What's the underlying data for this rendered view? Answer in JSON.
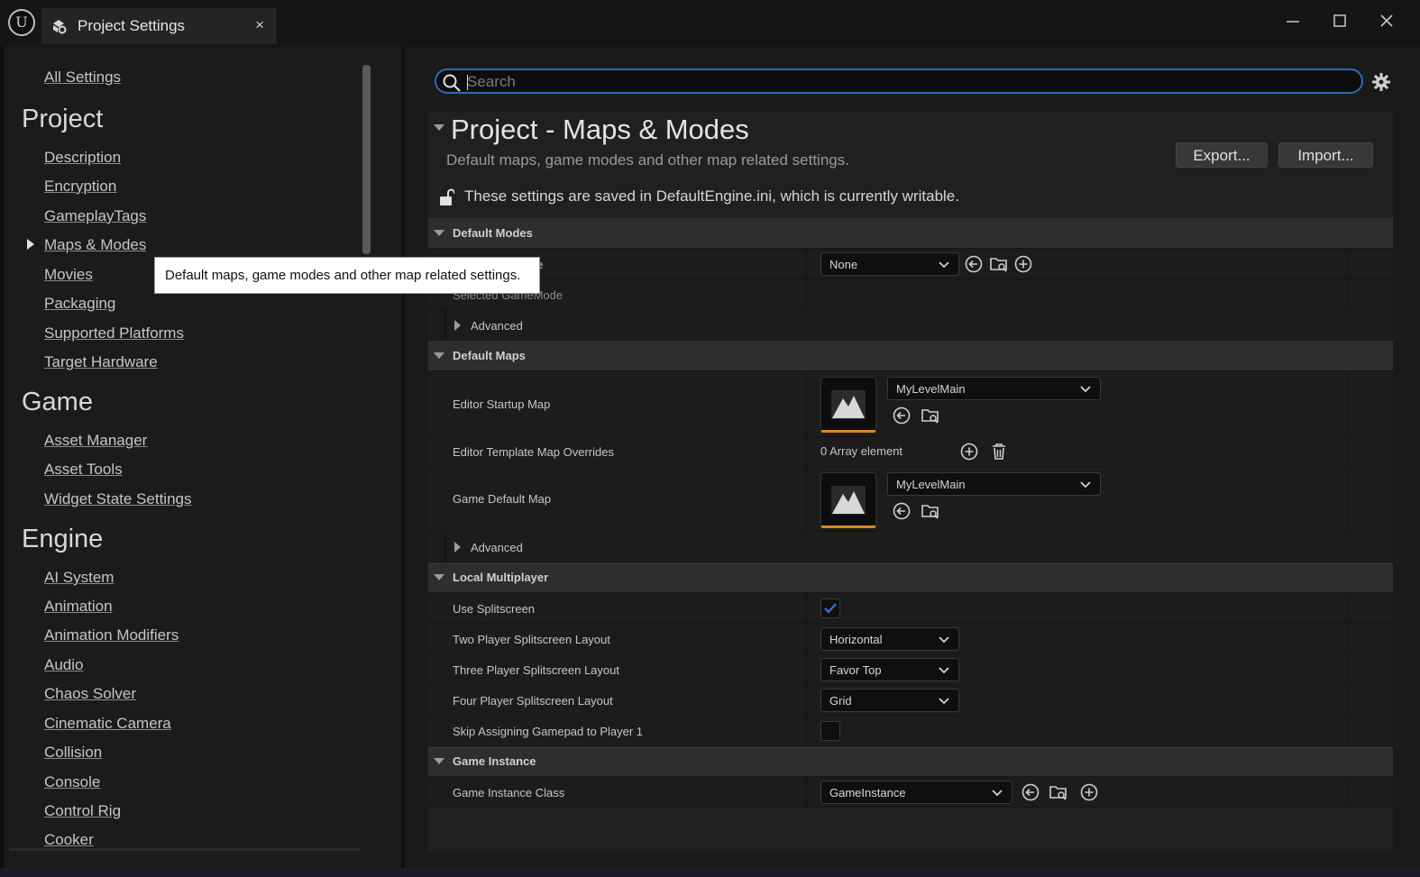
{
  "window": {
    "tab_title": "Project Settings",
    "close_glyph": "×",
    "minimize_glyph": "—",
    "maximize_glyph": "☐",
    "close_window_glyph": "✕"
  },
  "sidebar": {
    "all_settings": "All Settings",
    "sections": [
      {
        "title": "Project",
        "items": [
          "Description",
          "Encryption",
          "GameplayTags",
          "Maps & Modes",
          "Movies",
          "Packaging",
          "Supported Platforms",
          "Target Hardware"
        ]
      },
      {
        "title": "Game",
        "items": [
          "Asset Manager",
          "Asset Tools",
          "Widget State Settings"
        ]
      },
      {
        "title": "Engine",
        "items": [
          "AI System",
          "Animation",
          "Animation Modifiers",
          "Audio",
          "Chaos Solver",
          "Cinematic Camera",
          "Collision",
          "Console",
          "Control Rig",
          "Cooker"
        ]
      }
    ],
    "selected_item": "Maps & Modes"
  },
  "tooltip": {
    "text": "Default maps, game modes and other map related settings."
  },
  "search": {
    "placeholder": "Search",
    "value": ""
  },
  "header": {
    "title": "Project - Maps & Modes",
    "description": "Default maps, game modes and other map related settings.",
    "export_label": "Export...",
    "import_label": "Import...",
    "writable_notice": "These settings are saved in DefaultEngine.ini, which is currently writable."
  },
  "default_modes": {
    "label": "Default Modes",
    "default_gamemode_label": "de",
    "default_gamemode_value": "None",
    "selected_gamemode_label": "Selected GameMode",
    "advanced_label": "Advanced"
  },
  "default_maps": {
    "label": "Default Maps",
    "editor_startup_map_label": "Editor Startup Map",
    "editor_startup_map_value": "MyLevelMain",
    "editor_template_overrides_label": "Editor Template Map Overrides",
    "editor_template_overrides_value": "0 Array element",
    "game_default_map_label": "Game Default Map",
    "game_default_map_value": "MyLevelMain",
    "advanced_label": "Advanced"
  },
  "local_multiplayer": {
    "label": "Local Multiplayer",
    "use_splitscreen_label": "Use Splitscreen",
    "use_splitscreen_checked": true,
    "two_player_label": "Two Player Splitscreen Layout",
    "two_player_value": "Horizontal",
    "three_player_label": "Three Player Splitscreen Layout",
    "three_player_value": "Favor Top",
    "four_player_label": "Four Player Splitscreen Layout",
    "four_player_value": "Grid",
    "skip_gamepad_label": "Skip Assigning Gamepad to Player 1",
    "skip_gamepad_checked": false
  },
  "game_instance": {
    "label": "Game Instance",
    "class_label": "Game Instance Class",
    "class_value": "GameInstance"
  },
  "colors": {
    "accent_blue": "#2c6ab8",
    "checkbox_blue": "#2f6fd0",
    "thumbnail_orange": "#d88a1a"
  }
}
